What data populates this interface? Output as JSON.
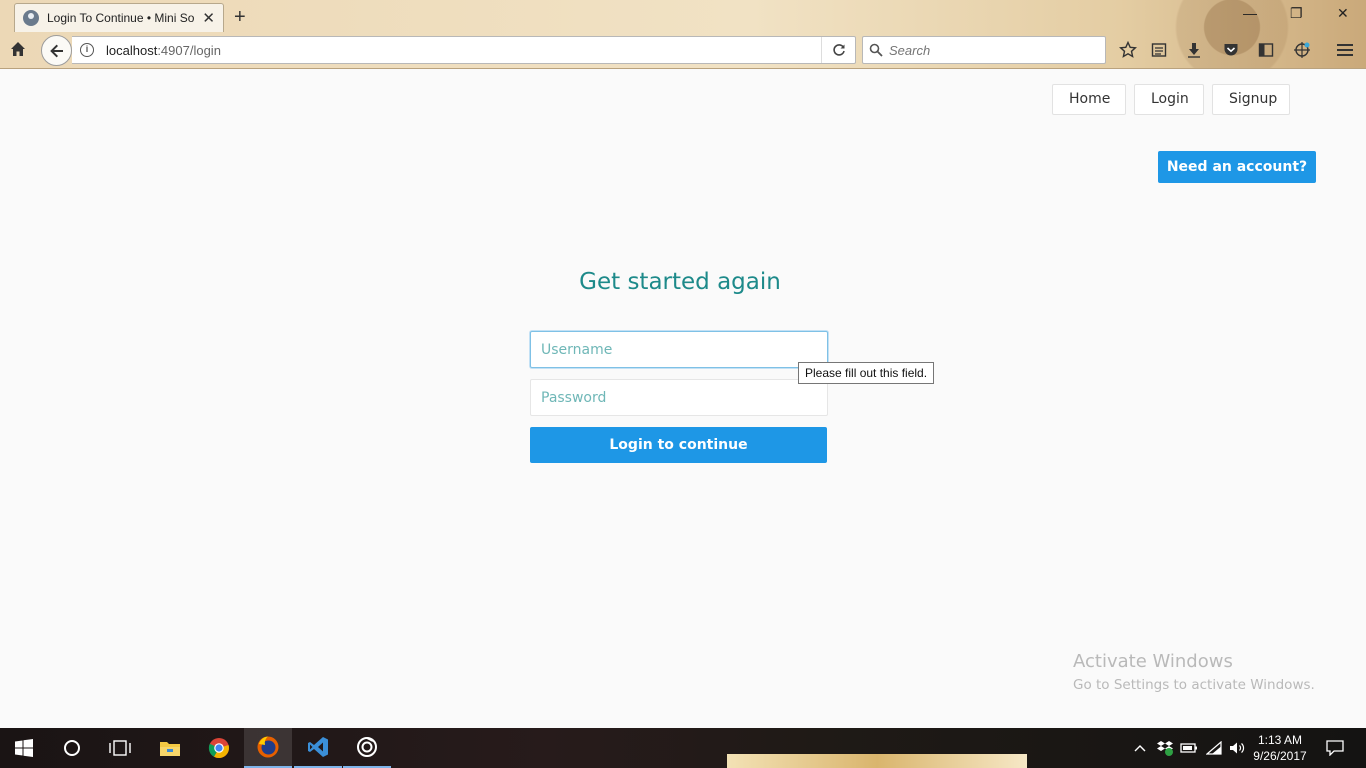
{
  "browser": {
    "tab_title": "Login To Continue • Mini So",
    "url_host": "localhost",
    "url_rest": ":4907/login",
    "search_placeholder": "Search"
  },
  "nav": {
    "home": "Home",
    "login": "Login",
    "signup": "Signup"
  },
  "cta": {
    "need_account": "Need an account?"
  },
  "login_form": {
    "heading": "Get started again",
    "username_placeholder": "Username",
    "password_placeholder": "Password",
    "submit_label": "Login to continue",
    "validation_tooltip": "Please fill out this field."
  },
  "watermark": {
    "line1": "Activate Windows",
    "line2": "Go to Settings to activate Windows."
  },
  "taskbar": {
    "time": "1:13 AM",
    "date": "9/26/2017",
    "apps": [
      "windows-start-icon",
      "cortana-icon",
      "task-view-icon",
      "file-explorer-icon",
      "chrome-icon",
      "firefox-icon",
      "vscode-icon",
      "groove-icon"
    ]
  },
  "colors": {
    "accent": "#1e97e6",
    "heading": "#1d8a8a"
  }
}
